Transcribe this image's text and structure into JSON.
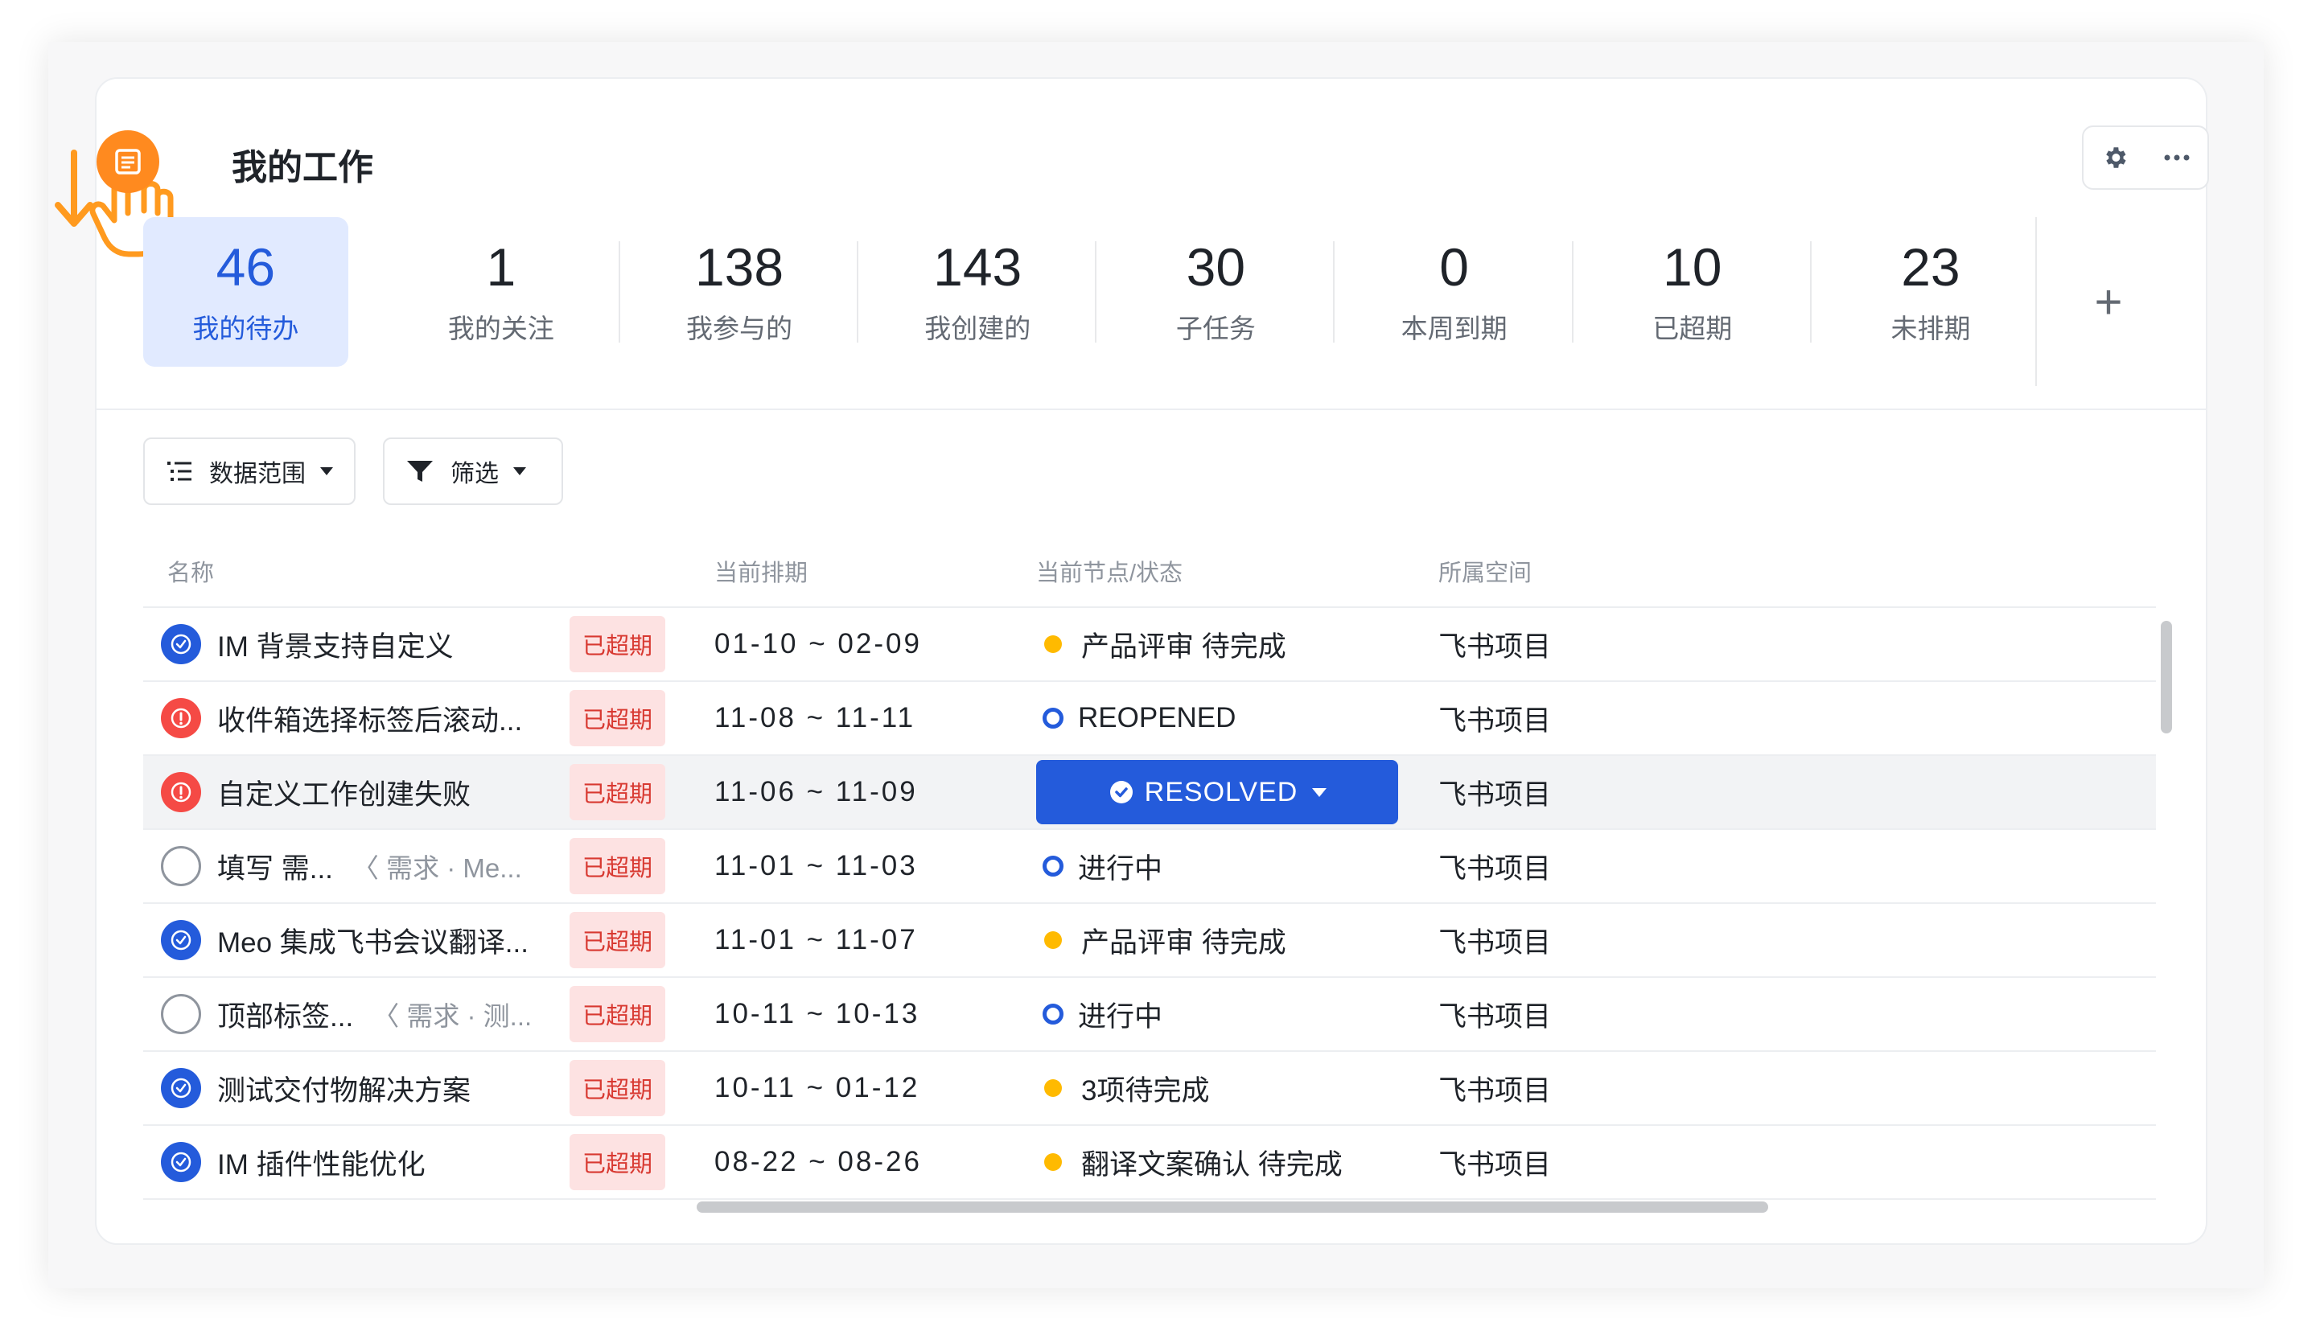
{
  "header": {
    "title": "我的工作",
    "app_icon": "list-icon",
    "tools": [
      "gear-icon",
      "more-icon"
    ]
  },
  "stats": [
    {
      "value": "46",
      "label": "我的待办",
      "active": true
    },
    {
      "value": "1",
      "label": "我的关注"
    },
    {
      "value": "138",
      "label": "我参与的"
    },
    {
      "value": "143",
      "label": "我创建的"
    },
    {
      "value": "30",
      "label": "子任务"
    },
    {
      "value": "0",
      "label": "本周到期"
    },
    {
      "value": "10",
      "label": "已超期"
    },
    {
      "value": "23",
      "label": "未排期"
    }
  ],
  "add_label": "+",
  "toolbar": {
    "range_label": "数据范围",
    "filter_label": "筛选"
  },
  "table": {
    "columns": [
      "名称",
      "当前排期",
      "当前节点/状态",
      "所属空间"
    ],
    "rows": [
      {
        "icon": "done",
        "name": "IM 背景支持自定义",
        "tag": "已超期",
        "date": "01-10 ~ 02-09",
        "status_type": "dot",
        "status": "产品评审 待完成",
        "space": "飞书项目"
      },
      {
        "icon": "err",
        "name": "收件箱选择标签后滚动...",
        "tag": "已超期",
        "date": "11-08 ~ 11-11",
        "status_type": "ring",
        "status": "REOPENED",
        "space": "飞书项目"
      },
      {
        "icon": "err",
        "name": "自定义工作创建失败",
        "tag": "已超期",
        "date": "11-06 ~ 11-09",
        "status_type": "button",
        "status": "RESOLVED",
        "space": "飞书项目"
      },
      {
        "icon": "empty",
        "name": "填写 需...",
        "parent": "〈 需求 · Me...",
        "tag": "已超期",
        "date": "11-01 ~ 11-03",
        "status_type": "ring",
        "status": "进行中",
        "space": "飞书项目"
      },
      {
        "icon": "done",
        "name": "Meo 集成飞书会议翻译...",
        "tag": "已超期",
        "date": "11-01 ~ 11-07",
        "status_type": "dot",
        "status": "产品评审 待完成",
        "space": "飞书项目"
      },
      {
        "icon": "empty",
        "name": "顶部标签...",
        "parent": "〈 需求 · 测...",
        "tag": "已超期",
        "date": "10-11 ~ 10-13",
        "status_type": "ring",
        "status": "进行中",
        "space": "飞书项目"
      },
      {
        "icon": "done",
        "name": "测试交付物解决方案",
        "tag": "已超期",
        "date": "10-11 ~ 01-12",
        "status_type": "dot",
        "status": "3项待完成",
        "space": "飞书项目"
      },
      {
        "icon": "done",
        "name": "IM 插件性能优化",
        "tag": "已超期",
        "date": "08-22 ~ 08-26",
        "status_type": "dot",
        "status": "翻译文案确认 待完成",
        "space": "飞书项目"
      }
    ]
  },
  "colors": {
    "accent": "#245bdb",
    "overdue_bg": "#fde2e2",
    "overdue_text": "#d83931",
    "orange": "#ff8a1f",
    "status_dot": "#ffba00"
  }
}
